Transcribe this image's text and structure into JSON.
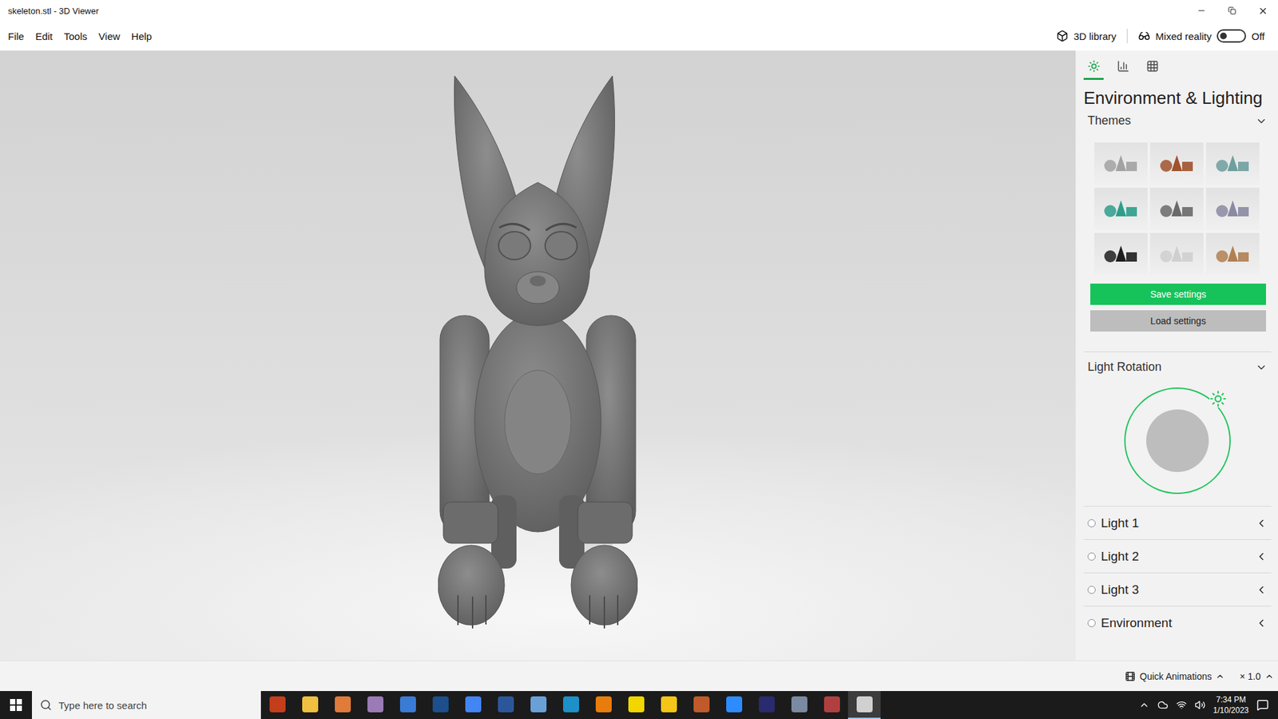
{
  "window": {
    "title": "skeleton.stl - 3D Viewer"
  },
  "menu": [
    {
      "label": "File"
    },
    {
      "label": "Edit"
    },
    {
      "label": "Tools"
    },
    {
      "label": "View"
    },
    {
      "label": "Help"
    }
  ],
  "toolbar": {
    "library": "3D library",
    "mixed_reality": {
      "label": "Mixed reality",
      "on": false,
      "state_label": "Off"
    }
  },
  "panel": {
    "tabs": [
      {
        "name": "lighting",
        "selected": true
      },
      {
        "name": "stats",
        "selected": false
      },
      {
        "name": "grid",
        "selected": false
      }
    ],
    "title": "Environment & Lighting",
    "themes": {
      "label": "Themes",
      "expanded": true,
      "items": [
        {
          "color": "#a2a2a2"
        },
        {
          "color": "#a0522d"
        },
        {
          "color": "#6f9e9e"
        },
        {
          "color": "#2e9e8a"
        },
        {
          "color": "#6a6a6a"
        },
        {
          "color": "#8a8aa2"
        },
        {
          "color": "#1e1e1e"
        },
        {
          "color": "#cfcfcf"
        },
        {
          "color": "#b08050"
        }
      ]
    },
    "save": "Save settings",
    "load": "Load settings",
    "light_rotation": {
      "label": "Light Rotation",
      "expanded": true
    },
    "lights": [
      {
        "label": "Light 1",
        "on": false,
        "expanded": false
      },
      {
        "label": "Light 2",
        "on": false,
        "expanded": false
      },
      {
        "label": "Light 3",
        "on": false,
        "expanded": false
      },
      {
        "label": "Environment",
        "on": false,
        "expanded": false
      }
    ]
  },
  "status_bar": {
    "animations": "Quick Animations",
    "speed": "× 1.0"
  },
  "taskbar": {
    "search_placeholder": "Type here to search",
    "time": "7:34 PM",
    "date": "1/10/2023",
    "apps": [
      {
        "color": "#c43e1c",
        "selected": false
      },
      {
        "color": "#f0c040",
        "selected": false
      },
      {
        "color": "#e07b39",
        "selected": false
      },
      {
        "color": "#9b7bb6",
        "selected": false
      },
      {
        "color": "#3a7bd5",
        "selected": false
      },
      {
        "color": "#1c4f8c",
        "selected": false
      },
      {
        "color": "#4285f4",
        "selected": false
      },
      {
        "color": "#2b579a",
        "selected": false
      },
      {
        "color": "#6aa0d8",
        "selected": false
      },
      {
        "color": "#1e90c8",
        "selected": false
      },
      {
        "color": "#e87d0d",
        "selected": false
      },
      {
        "color": "#f2d600",
        "selected": false
      },
      {
        "color": "#f5c518",
        "selected": false
      },
      {
        "color": "#c05a2b",
        "selected": false
      },
      {
        "color": "#2d8cff",
        "selected": false
      },
      {
        "color": "#2a2a6e",
        "selected": false
      },
      {
        "color": "#7a8aa0",
        "selected": false
      },
      {
        "color": "#b04040",
        "selected": false
      },
      {
        "color": "#d0d0d0",
        "selected": true
      }
    ]
  }
}
